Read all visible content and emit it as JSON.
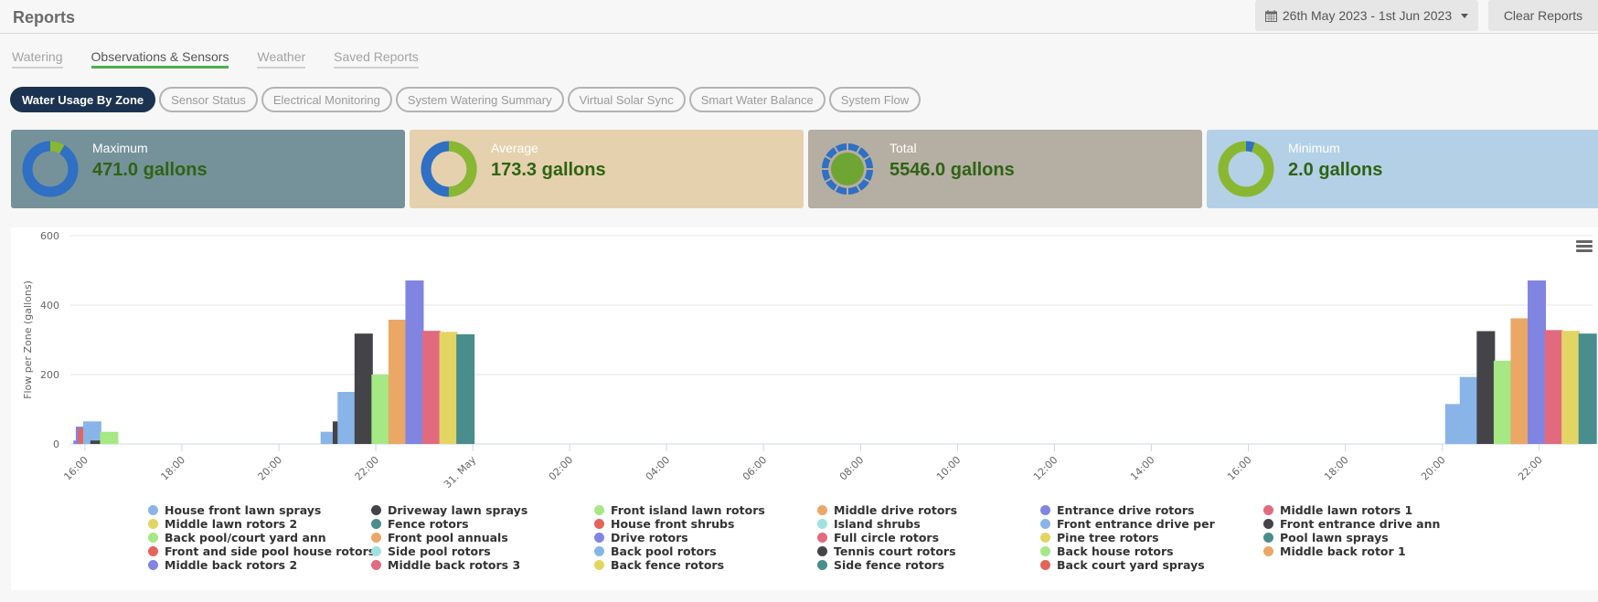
{
  "header": {
    "title": "Reports",
    "date_range": "26th May 2023 - 1st Jun 2023",
    "clear_label": "Clear Reports"
  },
  "tabs": [
    {
      "label": "Watering",
      "active": false
    },
    {
      "label": "Observations & Sensors",
      "active": true
    },
    {
      "label": "Weather",
      "active": false
    },
    {
      "label": "Saved Reports",
      "active": false
    }
  ],
  "pills": [
    {
      "label": "Water Usage By Zone",
      "active": true
    },
    {
      "label": "Sensor Status",
      "active": false
    },
    {
      "label": "Electrical Monitoring",
      "active": false
    },
    {
      "label": "System Watering Summary",
      "active": false
    },
    {
      "label": "Virtual Solar Sync",
      "active": false
    },
    {
      "label": "Smart Water Balance",
      "active": false
    },
    {
      "label": "System Flow",
      "active": false
    }
  ],
  "cards": [
    {
      "label": "Maximum",
      "value": "471.0 gallons",
      "bg": "#75929a",
      "donut_fraction": 0.085
    },
    {
      "label": "Average",
      "value": "173.3 gallons",
      "bg": "#e5d1ad",
      "donut_fraction": 0.5
    },
    {
      "label": "Total",
      "value": "5546.0 gallons",
      "bg": "#b5aea2",
      "donut_fraction": 1
    },
    {
      "label": "Minimum",
      "value": "2.0 gallons",
      "bg": "#b3d0e6",
      "donut_fraction": 0.95
    }
  ],
  "chart_data": {
    "type": "bar",
    "title": "",
    "xlabel": "",
    "ylabel": "Flow per Zone (gallons)",
    "ylim": [
      0,
      600
    ],
    "yticks": [
      "0",
      "200",
      "400",
      "600"
    ],
    "xticks": [
      "16:00",
      "18:00",
      "20:00",
      "22:00",
      "31. May",
      "02:00",
      "04:00",
      "06:00",
      "08:00",
      "10:00",
      "12:00",
      "14:00",
      "16:00",
      "18:00",
      "20:00",
      "22:00"
    ],
    "x_range_hours": [
      15.7,
      47.1
    ],
    "grid": true,
    "legend_position": "bottom",
    "bars": [
      {
        "hour": 15.95,
        "value": 10,
        "series": "Middle back rotors 2",
        "color": "#8085e2"
      },
      {
        "hour": 16.0,
        "value": 50,
        "series": "Drive rotors",
        "color": "#8085e2"
      },
      {
        "hour": 16.05,
        "value": 45,
        "series": "House front shrubs",
        "color": "#e4645a"
      },
      {
        "hour": 16.15,
        "value": 65,
        "series": "House front lawn sprays",
        "color": "#89b4e7"
      },
      {
        "hour": 16.3,
        "value": 10,
        "series": "Driveway lawn sprays",
        "color": "#434348"
      },
      {
        "hour": 16.5,
        "value": 35,
        "series": "Front island lawn rotors",
        "color": "#a5e884"
      },
      {
        "hour": 21.05,
        "value": 35,
        "series": "Back pool rotors",
        "color": "#89b4e7"
      },
      {
        "hour": 21.3,
        "value": 65,
        "series": "Driveway lawn sprays",
        "color": "#434348"
      },
      {
        "hour": 21.4,
        "value": 150,
        "series": "House front lawn sprays",
        "color": "#89b4e7"
      },
      {
        "hour": 21.75,
        "value": 318,
        "series": "Tennis court rotors",
        "color": "#434348"
      },
      {
        "hour": 22.1,
        "value": 200,
        "series": "Front island lawn rotors",
        "color": "#a5e884"
      },
      {
        "hour": 22.45,
        "value": 358,
        "series": "Middle drive rotors",
        "color": "#eaa765"
      },
      {
        "hour": 22.8,
        "value": 471,
        "series": "Entrance drive rotors",
        "color": "#8085e2"
      },
      {
        "hour": 23.15,
        "value": 326,
        "series": "Middle lawn rotors 1",
        "color": "#e26a7e"
      },
      {
        "hour": 23.5,
        "value": 323,
        "series": "Middle lawn rotors 2",
        "color": "#e2d563"
      },
      {
        "hour": 23.85,
        "value": 316,
        "series": "Fence rotors",
        "color": "#4a8d8d"
      },
      {
        "hour": 44.25,
        "value": 115,
        "series": "Back pool rotors",
        "color": "#89b4e7"
      },
      {
        "hour": 44.55,
        "value": 193,
        "series": "House front lawn sprays",
        "color": "#89b4e7"
      },
      {
        "hour": 44.9,
        "value": 325,
        "series": "Driveway lawn sprays",
        "color": "#434348"
      },
      {
        "hour": 45.25,
        "value": 240,
        "series": "Front island lawn rotors",
        "color": "#a5e884"
      },
      {
        "hour": 45.6,
        "value": 362,
        "series": "Middle drive rotors",
        "color": "#eaa765"
      },
      {
        "hour": 45.95,
        "value": 471,
        "series": "Entrance drive rotors",
        "color": "#8085e2"
      },
      {
        "hour": 46.3,
        "value": 328,
        "series": "Middle lawn rotors 1",
        "color": "#e26a7e"
      },
      {
        "hour": 46.65,
        "value": 326,
        "series": "Middle lawn rotors 2",
        "color": "#e2d563"
      },
      {
        "hour": 47.0,
        "value": 318,
        "series": "Fence rotors",
        "color": "#4a8d8d"
      }
    ],
    "legend": [
      {
        "name": "House front lawn sprays",
        "color": "#89b4e7"
      },
      {
        "name": "Driveway lawn sprays",
        "color": "#434348"
      },
      {
        "name": "Front island lawn rotors",
        "color": "#a5e884"
      },
      {
        "name": "Middle drive rotors",
        "color": "#eaa765"
      },
      {
        "name": "Entrance drive rotors",
        "color": "#8085e2"
      },
      {
        "name": "Middle lawn rotors 1",
        "color": "#e26a7e"
      },
      {
        "name": "Middle lawn rotors 2",
        "color": "#e2d563"
      },
      {
        "name": "Fence rotors",
        "color": "#4a8d8d"
      },
      {
        "name": "House front shrubs",
        "color": "#e4645a"
      },
      {
        "name": "Island shrubs",
        "color": "#9ee3e2"
      },
      {
        "name": "Front entrance drive per",
        "color": "#89b4e7"
      },
      {
        "name": "Front entrance drive ann",
        "color": "#434348"
      },
      {
        "name": "Back pool/court yard ann",
        "color": "#a5e884"
      },
      {
        "name": "Front pool annuals",
        "color": "#eaa765"
      },
      {
        "name": "Drive rotors",
        "color": "#8085e2"
      },
      {
        "name": "Full circle rotors",
        "color": "#e26a7e"
      },
      {
        "name": "Pine tree rotors",
        "color": "#e2d563"
      },
      {
        "name": "Pool lawn sprays",
        "color": "#4a8d8d"
      },
      {
        "name": "Front and side pool house rotors",
        "color": "#e4645a"
      },
      {
        "name": "Side pool rotors",
        "color": "#9ee3e2"
      },
      {
        "name": "Back pool rotors",
        "color": "#89b4e7"
      },
      {
        "name": "Tennis court rotors",
        "color": "#434348"
      },
      {
        "name": "Back house rotors",
        "color": "#a5e884"
      },
      {
        "name": "Middle back rotor 1",
        "color": "#eaa765"
      },
      {
        "name": "Middle back rotors 2",
        "color": "#8085e2"
      },
      {
        "name": "Middle back rotors 3",
        "color": "#e26a7e"
      },
      {
        "name": "Back fence rotors",
        "color": "#e2d563"
      },
      {
        "name": "Side fence rotors",
        "color": "#4a8d8d"
      },
      {
        "name": "Back court yard sprays",
        "color": "#e4645a"
      }
    ]
  }
}
